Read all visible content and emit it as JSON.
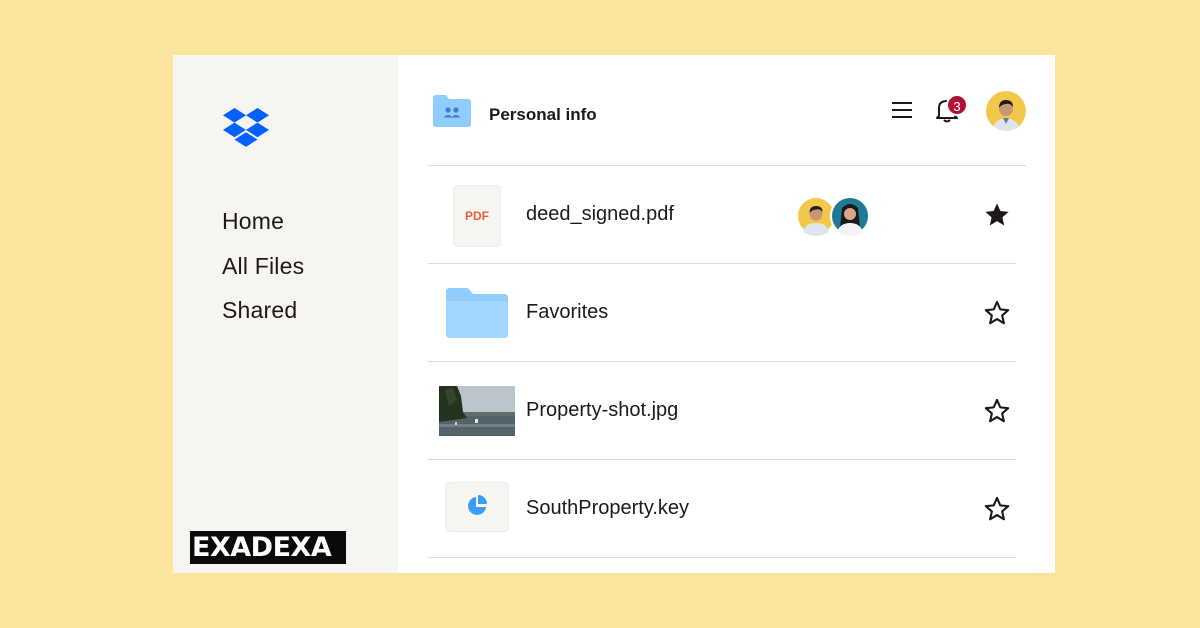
{
  "sidebar": {
    "items": [
      {
        "label": "Home"
      },
      {
        "label": "All Files"
      },
      {
        "label": "Shared"
      }
    ]
  },
  "watermark": "EXADEXA",
  "header": {
    "title": "Personal info",
    "notification_count": "3"
  },
  "files": [
    {
      "name": "deed_signed.pdf",
      "type": "pdf",
      "type_label": "PDF",
      "starred": true,
      "shared_with": 2
    },
    {
      "name": "Favorites",
      "type": "folder",
      "starred": false
    },
    {
      "name": "Property-shot.jpg",
      "type": "image",
      "starred": false
    },
    {
      "name": "SouthProperty.key",
      "type": "keynote",
      "starred": false
    }
  ],
  "icons": {
    "logo": "dropbox-logo",
    "menu": "hamburger-icon",
    "notifications": "bell-icon",
    "star_filled": "star-filled-icon",
    "star_empty": "star-outline-icon"
  },
  "colors": {
    "page_bg": "#fde49c",
    "sidebar_bg": "#f7f5f2",
    "brand_blue": "#0061fe",
    "folder_blue": "#90cdfd",
    "badge_red": "#b0103a",
    "pdf_orange": "#e8613d"
  }
}
